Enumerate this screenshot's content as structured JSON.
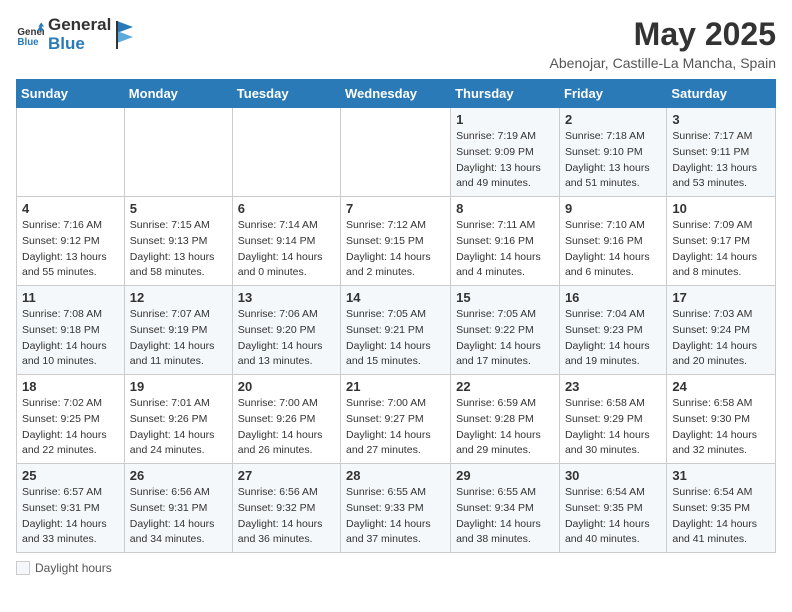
{
  "header": {
    "logo_line1": "General",
    "logo_line2": "Blue",
    "month_title": "May 2025",
    "subtitle": "Abenojar, Castille-La Mancha, Spain"
  },
  "weekdays": [
    "Sunday",
    "Monday",
    "Tuesday",
    "Wednesday",
    "Thursday",
    "Friday",
    "Saturday"
  ],
  "footer": {
    "daylight_label": "Daylight hours"
  },
  "weeks": [
    [
      {
        "day": "",
        "sunrise": "",
        "sunset": "",
        "daylight": ""
      },
      {
        "day": "",
        "sunrise": "",
        "sunset": "",
        "daylight": ""
      },
      {
        "day": "",
        "sunrise": "",
        "sunset": "",
        "daylight": ""
      },
      {
        "day": "",
        "sunrise": "",
        "sunset": "",
        "daylight": ""
      },
      {
        "day": "1",
        "sunrise": "Sunrise: 7:19 AM",
        "sunset": "Sunset: 9:09 PM",
        "daylight": "Daylight: 13 hours and 49 minutes."
      },
      {
        "day": "2",
        "sunrise": "Sunrise: 7:18 AM",
        "sunset": "Sunset: 9:10 PM",
        "daylight": "Daylight: 13 hours and 51 minutes."
      },
      {
        "day": "3",
        "sunrise": "Sunrise: 7:17 AM",
        "sunset": "Sunset: 9:11 PM",
        "daylight": "Daylight: 13 hours and 53 minutes."
      }
    ],
    [
      {
        "day": "4",
        "sunrise": "Sunrise: 7:16 AM",
        "sunset": "Sunset: 9:12 PM",
        "daylight": "Daylight: 13 hours and 55 minutes."
      },
      {
        "day": "5",
        "sunrise": "Sunrise: 7:15 AM",
        "sunset": "Sunset: 9:13 PM",
        "daylight": "Daylight: 13 hours and 58 minutes."
      },
      {
        "day": "6",
        "sunrise": "Sunrise: 7:14 AM",
        "sunset": "Sunset: 9:14 PM",
        "daylight": "Daylight: 14 hours and 0 minutes."
      },
      {
        "day": "7",
        "sunrise": "Sunrise: 7:12 AM",
        "sunset": "Sunset: 9:15 PM",
        "daylight": "Daylight: 14 hours and 2 minutes."
      },
      {
        "day": "8",
        "sunrise": "Sunrise: 7:11 AM",
        "sunset": "Sunset: 9:16 PM",
        "daylight": "Daylight: 14 hours and 4 minutes."
      },
      {
        "day": "9",
        "sunrise": "Sunrise: 7:10 AM",
        "sunset": "Sunset: 9:16 PM",
        "daylight": "Daylight: 14 hours and 6 minutes."
      },
      {
        "day": "10",
        "sunrise": "Sunrise: 7:09 AM",
        "sunset": "Sunset: 9:17 PM",
        "daylight": "Daylight: 14 hours and 8 minutes."
      }
    ],
    [
      {
        "day": "11",
        "sunrise": "Sunrise: 7:08 AM",
        "sunset": "Sunset: 9:18 PM",
        "daylight": "Daylight: 14 hours and 10 minutes."
      },
      {
        "day": "12",
        "sunrise": "Sunrise: 7:07 AM",
        "sunset": "Sunset: 9:19 PM",
        "daylight": "Daylight: 14 hours and 11 minutes."
      },
      {
        "day": "13",
        "sunrise": "Sunrise: 7:06 AM",
        "sunset": "Sunset: 9:20 PM",
        "daylight": "Daylight: 14 hours and 13 minutes."
      },
      {
        "day": "14",
        "sunrise": "Sunrise: 7:05 AM",
        "sunset": "Sunset: 9:21 PM",
        "daylight": "Daylight: 14 hours and 15 minutes."
      },
      {
        "day": "15",
        "sunrise": "Sunrise: 7:05 AM",
        "sunset": "Sunset: 9:22 PM",
        "daylight": "Daylight: 14 hours and 17 minutes."
      },
      {
        "day": "16",
        "sunrise": "Sunrise: 7:04 AM",
        "sunset": "Sunset: 9:23 PM",
        "daylight": "Daylight: 14 hours and 19 minutes."
      },
      {
        "day": "17",
        "sunrise": "Sunrise: 7:03 AM",
        "sunset": "Sunset: 9:24 PM",
        "daylight": "Daylight: 14 hours and 20 minutes."
      }
    ],
    [
      {
        "day": "18",
        "sunrise": "Sunrise: 7:02 AM",
        "sunset": "Sunset: 9:25 PM",
        "daylight": "Daylight: 14 hours and 22 minutes."
      },
      {
        "day": "19",
        "sunrise": "Sunrise: 7:01 AM",
        "sunset": "Sunset: 9:26 PM",
        "daylight": "Daylight: 14 hours and 24 minutes."
      },
      {
        "day": "20",
        "sunrise": "Sunrise: 7:00 AM",
        "sunset": "Sunset: 9:26 PM",
        "daylight": "Daylight: 14 hours and 26 minutes."
      },
      {
        "day": "21",
        "sunrise": "Sunrise: 7:00 AM",
        "sunset": "Sunset: 9:27 PM",
        "daylight": "Daylight: 14 hours and 27 minutes."
      },
      {
        "day": "22",
        "sunrise": "Sunrise: 6:59 AM",
        "sunset": "Sunset: 9:28 PM",
        "daylight": "Daylight: 14 hours and 29 minutes."
      },
      {
        "day": "23",
        "sunrise": "Sunrise: 6:58 AM",
        "sunset": "Sunset: 9:29 PM",
        "daylight": "Daylight: 14 hours and 30 minutes."
      },
      {
        "day": "24",
        "sunrise": "Sunrise: 6:58 AM",
        "sunset": "Sunset: 9:30 PM",
        "daylight": "Daylight: 14 hours and 32 minutes."
      }
    ],
    [
      {
        "day": "25",
        "sunrise": "Sunrise: 6:57 AM",
        "sunset": "Sunset: 9:31 PM",
        "daylight": "Daylight: 14 hours and 33 minutes."
      },
      {
        "day": "26",
        "sunrise": "Sunrise: 6:56 AM",
        "sunset": "Sunset: 9:31 PM",
        "daylight": "Daylight: 14 hours and 34 minutes."
      },
      {
        "day": "27",
        "sunrise": "Sunrise: 6:56 AM",
        "sunset": "Sunset: 9:32 PM",
        "daylight": "Daylight: 14 hours and 36 minutes."
      },
      {
        "day": "28",
        "sunrise": "Sunrise: 6:55 AM",
        "sunset": "Sunset: 9:33 PM",
        "daylight": "Daylight: 14 hours and 37 minutes."
      },
      {
        "day": "29",
        "sunrise": "Sunrise: 6:55 AM",
        "sunset": "Sunset: 9:34 PM",
        "daylight": "Daylight: 14 hours and 38 minutes."
      },
      {
        "day": "30",
        "sunrise": "Sunrise: 6:54 AM",
        "sunset": "Sunset: 9:35 PM",
        "daylight": "Daylight: 14 hours and 40 minutes."
      },
      {
        "day": "31",
        "sunrise": "Sunrise: 6:54 AM",
        "sunset": "Sunset: 9:35 PM",
        "daylight": "Daylight: 14 hours and 41 minutes."
      }
    ]
  ]
}
